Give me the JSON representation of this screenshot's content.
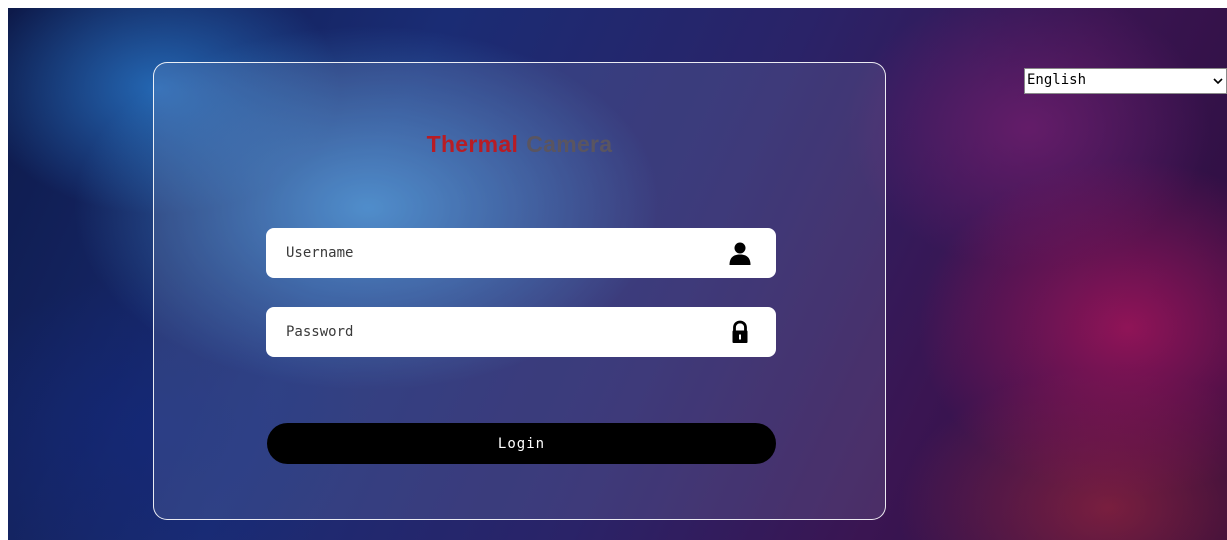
{
  "header": {
    "title_part1": "Thermal",
    "title_part2": "Camera"
  },
  "form": {
    "username_placeholder": "Username",
    "password_placeholder": "Password",
    "login_label": "Login"
  },
  "language": {
    "selected": "English"
  },
  "icons": {
    "username": "user-icon",
    "password": "lock-icon",
    "dropdown": "chevron-down-icon"
  },
  "colors": {
    "title_primary": "#b81c24",
    "title_secondary": "#5a5560",
    "button_bg": "#000000",
    "field_bg": "#ffffff"
  }
}
